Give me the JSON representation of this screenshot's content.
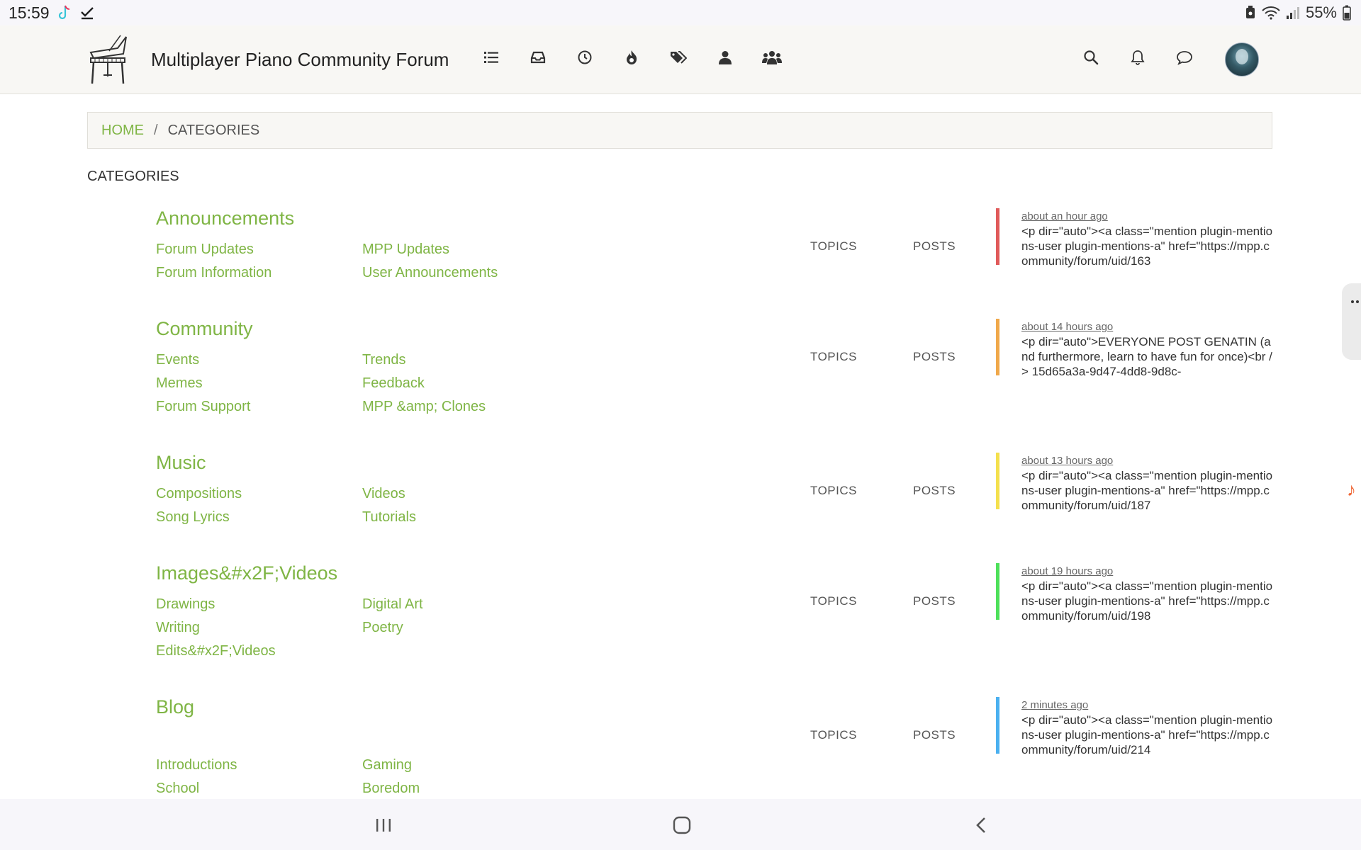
{
  "status_bar": {
    "time": "15:59",
    "battery": "55%",
    "icons": [
      "tiktok-icon",
      "check-icon",
      "battery-saver-icon",
      "wifi-icon",
      "signal-icon",
      "battery-icon"
    ]
  },
  "header": {
    "title": "Multiplayer Piano Community Forum",
    "nav_icons": [
      "categories-icon",
      "unread-icon",
      "recent-icon",
      "popular-icon",
      "tags-icon",
      "users-icon",
      "groups-icon"
    ],
    "right_icons": [
      "search-icon",
      "notifications-icon",
      "chat-icon"
    ]
  },
  "breadcrumb": {
    "home": "HOME",
    "separator": "/",
    "current": "CATEGORIES"
  },
  "page_title": "CATEGORIES",
  "categories": [
    {
      "title": "Announcements",
      "color": "#e05a5a",
      "subcategories": [
        "Forum Updates",
        "MPP Updates",
        "Forum Information",
        "User Announcements"
      ],
      "topics_label": "TOPICS",
      "posts_label": "POSTS",
      "teaser_time": "about an hour ago",
      "teaser_text": "<p dir=\"auto\"><a class=\"mention plugin-mentions-user plugin-mentions-a\" href=\"https://mpp.community/forum/uid/163"
    },
    {
      "title": "Community",
      "color": "#f0a84a",
      "subcategories": [
        "Events",
        "Trends",
        "Memes",
        "Feedback",
        "Forum Support",
        "MPP &amp; Clones"
      ],
      "topics_label": "TOPICS",
      "posts_label": "POSTS",
      "teaser_time": "about 14 hours ago",
      "teaser_text": "<p dir=\"auto\">EVERYONE POST GENATIN (and furthermore, learn to have fun for once)<br /> 15d65a3a-9d47-4dd8-9d8c-"
    },
    {
      "title": "Music",
      "color": "#f4e04d",
      "subcategories": [
        "Compositions",
        "Videos",
        "Song Lyrics",
        "Tutorials"
      ],
      "topics_label": "TOPICS",
      "posts_label": "POSTS",
      "teaser_time": "about 13 hours ago",
      "teaser_text": "<p dir=\"auto\"><a class=\"mention plugin-mentions-user plugin-mentions-a\" href=\"https://mpp.community/forum/uid/187"
    },
    {
      "title": "Images&#x2F;Videos",
      "color": "#4de05a",
      "subcategories": [
        "Drawings",
        "Digital Art",
        "Writing",
        "Poetry",
        "Edits&#x2F;Videos"
      ],
      "topics_label": "TOPICS",
      "posts_label": "POSTS",
      "teaser_time": "about 19 hours ago",
      "teaser_text": "<p dir=\"auto\"><a class=\"mention plugin-mentions-user plugin-mentions-a\" href=\"https://mpp.community/forum/uid/198"
    },
    {
      "title": "Blog",
      "color": "#4ab0f0",
      "subcategories": [
        "Introductions",
        "Gaming",
        "School",
        "Boredom"
      ],
      "topics_label": "TOPICS",
      "posts_label": "POSTS",
      "teaser_time": "2 minutes ago",
      "teaser_text": "<p dir=\"auto\"><a class=\"mention plugin-mentions-user plugin-mentions-a\" href=\"https://mpp.community/forum/uid/214"
    }
  ],
  "bottom_nav": [
    "recent-apps-icon",
    "home-icon",
    "back-icon"
  ]
}
